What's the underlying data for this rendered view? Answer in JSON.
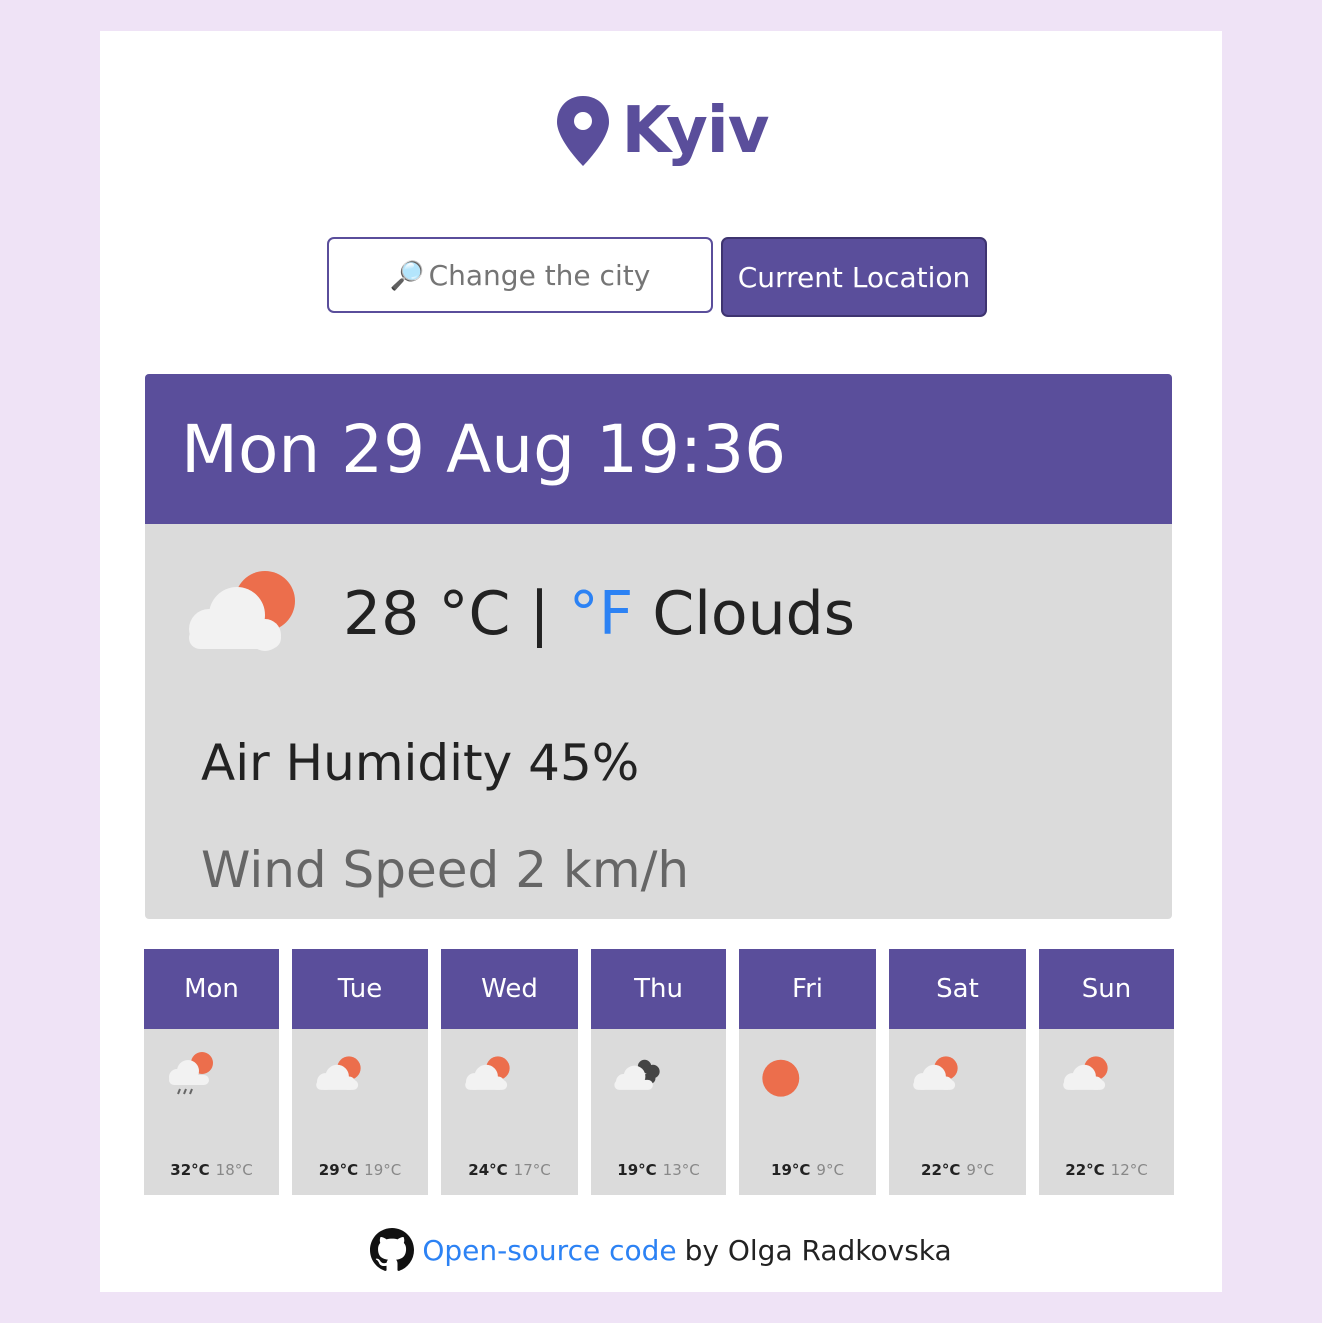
{
  "header": {
    "city": "Kyiv",
    "pin_icon": "map-pin-icon"
  },
  "search": {
    "placeholder": "Change the city",
    "icon": "magnifier-icon",
    "button": "Current Location"
  },
  "current": {
    "datetime": "Mon 29 Aug 19:36",
    "icon": "partly-cloudy-icon",
    "temperature": "28",
    "unit_c": "°C",
    "separator": "|",
    "unit_f": "°F",
    "description": "Clouds",
    "humidity_label": "Air Humidity",
    "humidity": "45%",
    "wind_label": "Wind Speed",
    "wind": "2 km/h"
  },
  "forecast": [
    {
      "day": "Mon",
      "icon": "rain-partly-cloudy-icon",
      "max": "32°C",
      "min": "18°C"
    },
    {
      "day": "Tue",
      "icon": "partly-cloudy-icon",
      "max": "29°C",
      "min": "19°C"
    },
    {
      "day": "Wed",
      "icon": "partly-cloudy-icon",
      "max": "24°C",
      "min": "17°C"
    },
    {
      "day": "Thu",
      "icon": "dark-clouds-icon",
      "max": "19°C",
      "min": "13°C"
    },
    {
      "day": "Fri",
      "icon": "sun-icon",
      "max": "19°C",
      "min": "9°C"
    },
    {
      "day": "Sat",
      "icon": "partly-cloudy-icon",
      "max": "22°C",
      "min": "9°C"
    },
    {
      "day": "Sun",
      "icon": "partly-cloudy-icon",
      "max": "22°C",
      "min": "12°C"
    }
  ],
  "footer": {
    "icon": "github-icon",
    "link_text": "Open-source code",
    "author": "by Olga Radkovska"
  },
  "colors": {
    "accent": "#5a4e9b",
    "background": "#efe3f6",
    "panel": "#dbdbdb",
    "link": "#2c82f4",
    "sun": "#ec6e4c"
  }
}
